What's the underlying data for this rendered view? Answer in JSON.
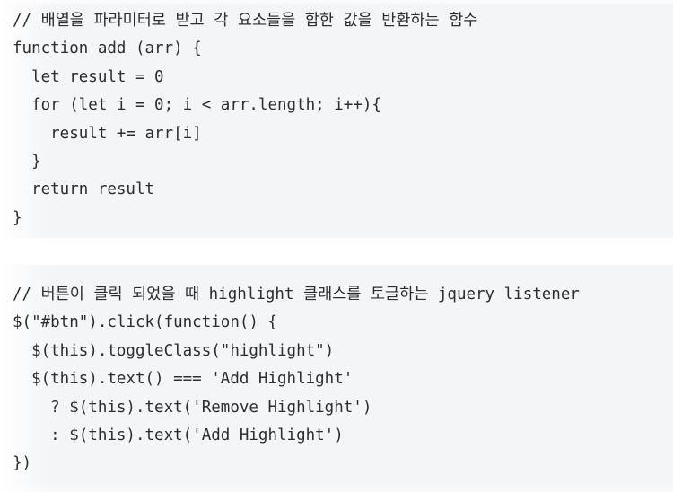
{
  "page": {
    "background_color": "#f4f5f7",
    "text_color": "#2d2d2d",
    "separator_color": "#ffffff"
  },
  "blocks": [
    {
      "id": "add-function-snippet",
      "language": "javascript",
      "comment": "// 배열을 파라미터로 받고 각 요소들을 합한 값을 반환하는 함수",
      "code": "// 배열을 파라미터로 받고 각 요소들을 합한 값을 반환하는 함수\nfunction add (arr) {\n  let result = 0\n  for (let i = 0; i < arr.length; i++){\n    result += arr[i]\n  }\n  return result\n}",
      "lines": [
        "// 배열을 파라미터로 받고 각 요소들을 합한 값을 반환하는 함수",
        "function add (arr) {",
        "  let result = 0",
        "  for (let i = 0; i < arr.length; i++){",
        "    result += arr[i]",
        "  }",
        "  return result",
        "}"
      ]
    },
    {
      "id": "jquery-toggle-snippet",
      "language": "javascript",
      "comment": "// 버튼이 클릭 되었을 때 highlight 클래스를 토글하는 jquery listener",
      "code": "// 버튼이 클릭 되었을 때 highlight 클래스를 토글하는 jquery listener\n$(\"#btn\").click(function() {\n  $(this).toggleClass(\"highlight\")\n  $(this).text() === 'Add Highlight'\n    ? $(this).text('Remove Highlight')\n    : $(this).text('Add Highlight')\n})",
      "lines": [
        "// 버튼이 클릭 되었을 때 highlight 클래스를 토글하는 jquery listener",
        "$(\"#btn\").click(function() {",
        "  $(this).toggleClass(\"highlight\")",
        "  $(this).text() === 'Add Highlight'",
        "    ? $(this).text('Remove Highlight')",
        "    : $(this).text('Add Highlight')",
        "})"
      ]
    }
  ]
}
